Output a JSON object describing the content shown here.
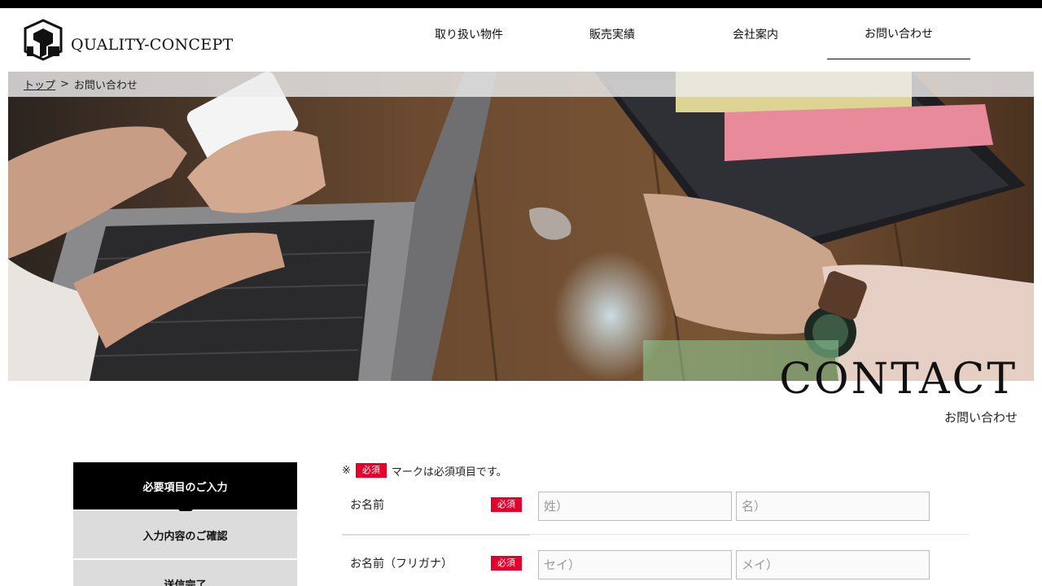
{
  "header": {
    "logo_text": "QUALITY-CONCEPT",
    "nav": [
      {
        "label": "取り扱い物件"
      },
      {
        "label": "販売実績"
      },
      {
        "label": "会社案内"
      },
      {
        "label": "お問い合わせ"
      }
    ]
  },
  "breadcrumb": {
    "home": "トップ",
    "separator": ">",
    "current": "お問い合わせ"
  },
  "hero": {
    "title": "CONTACT",
    "subtitle": "お問い合わせ"
  },
  "steps": [
    {
      "label": "必要項目のご入力",
      "active": true
    },
    {
      "label": "入力内容のご確認",
      "active": false
    },
    {
      "label": "送信完了",
      "active": false
    }
  ],
  "form": {
    "note_prefix": "※",
    "required_badge": "必須",
    "note_suffix": "マークは必須項目です。",
    "name": {
      "label": "お名前",
      "last_placeholder": "姓）",
      "first_placeholder": "名）"
    },
    "kana": {
      "label": "お名前（フリガナ）",
      "last_placeholder": "セイ）",
      "first_placeholder": "メイ）"
    }
  },
  "colors": {
    "accent_red": "#e5002b",
    "step_active": "#000000",
    "step_inactive": "#dcdcdc"
  }
}
